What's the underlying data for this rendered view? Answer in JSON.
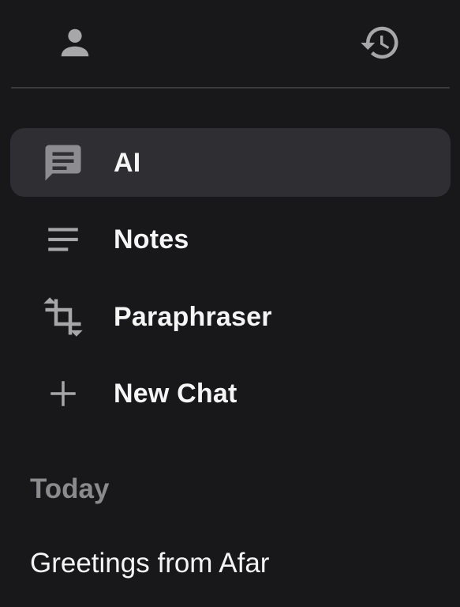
{
  "header": {
    "profile_icon": "person-icon",
    "history_icon": "history-icon"
  },
  "nav": {
    "items": [
      {
        "label": "AI",
        "icon": "chat-bubble-icon",
        "active": true
      },
      {
        "label": "Notes",
        "icon": "notes-lines-icon",
        "active": false
      },
      {
        "label": "Paraphraser",
        "icon": "crop-rotate-icon",
        "active": false
      },
      {
        "label": "New Chat",
        "icon": "plus-icon",
        "active": false
      }
    ]
  },
  "history": {
    "section_title": "Today",
    "items": [
      {
        "title": "Greetings from Afar"
      }
    ]
  },
  "colors": {
    "background": "#18181b",
    "active_item": "#2f2f33",
    "icon": "#a7a7aa",
    "muted_text": "#8b8b8e",
    "text": "#f5f5f5"
  }
}
